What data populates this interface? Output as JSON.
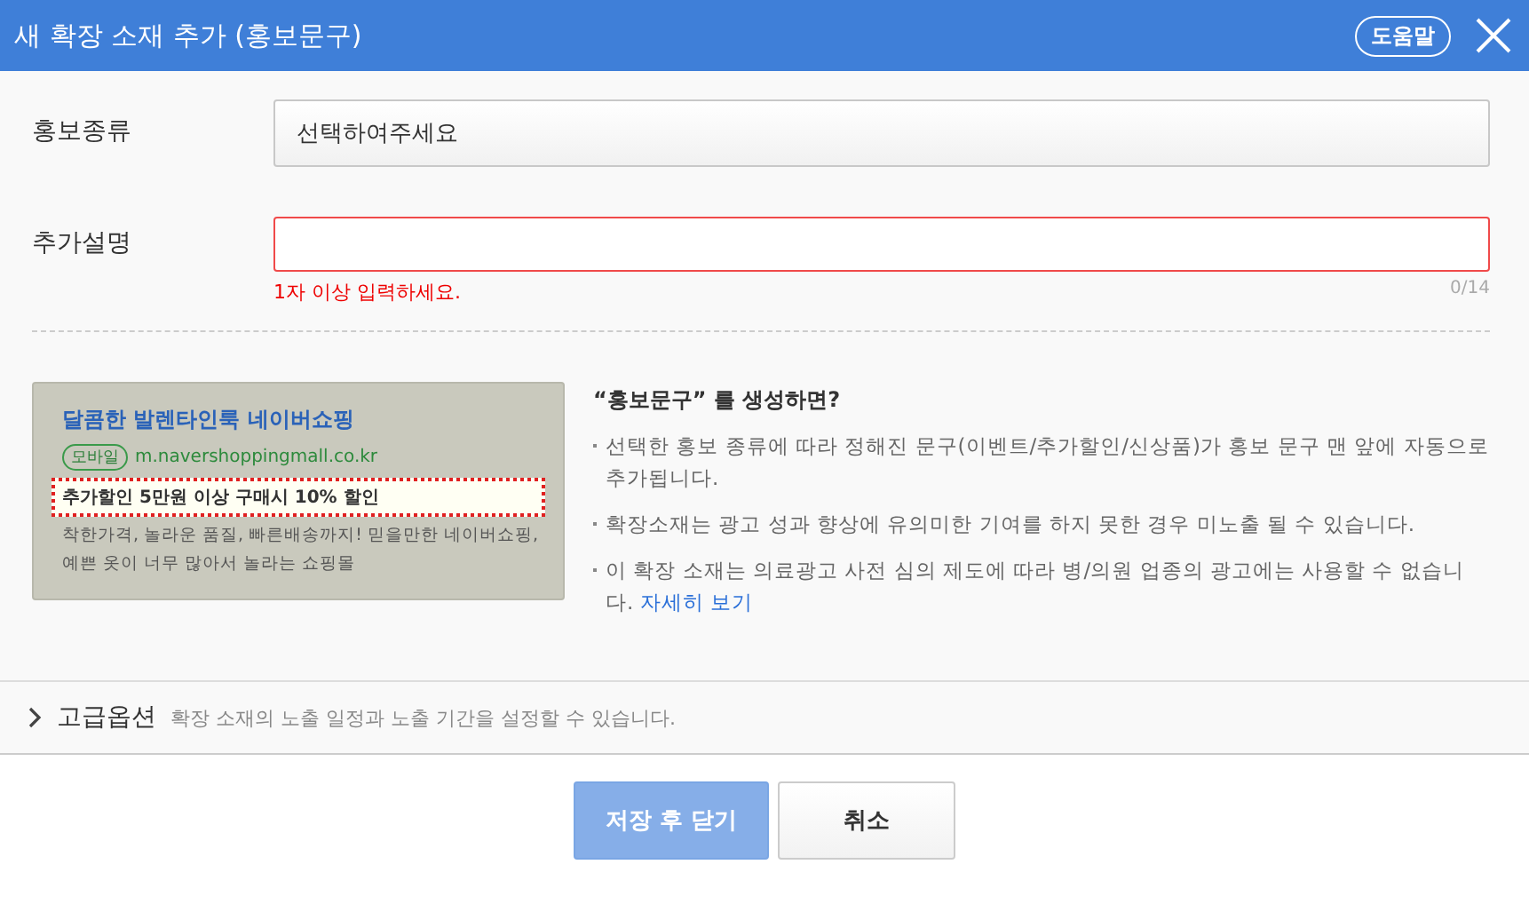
{
  "window": {
    "title": "새 확장 소재 추가 (홍보문구)",
    "help_button": "도움말"
  },
  "form": {
    "fields": [
      {
        "kind": "select",
        "label": "홍보종류",
        "value": "선택하여주세요"
      },
      {
        "kind": "text",
        "label": "추가설명",
        "invalid": true,
        "error": "1자 이상 입력하세요.",
        "counter": "0/14"
      }
    ]
  },
  "preview": {
    "title": "달콤한 발렌타인룩 네이버쇼핑",
    "badge": "모바일",
    "url": "m.navershoppingmall.co.kr",
    "highlight": "추가할인 5만원 이상 구매시 10% 할인",
    "description": "착한가격, 놀라운 품질, 빠른배송까지! 믿을만한 네이버쇼핑,\n예쁜 옷이 너무 많아서 놀라는 쇼핑몰"
  },
  "info": {
    "heading": "“홍보문구” 를 생성하면?",
    "bullets": [
      {
        "text": "선택한 홍보 종류에 따라 정해진 문구(이벤트/추가할인/신상품)가 홍보 문구 맨 앞에 자동으로 추가됩니다."
      },
      {
        "text": "확장소재는 광고 성과 향상에 유의미한 기여를 하지 못한 경우 미노출 될 수 있습니다."
      },
      {
        "text": "이 확장 소재는 의료광고 사전 심의 제도에 따라 병/의원 업종의 광고에는 사용할 수 없습니다.",
        "link": "자세히 보기"
      }
    ]
  },
  "advanced": {
    "label": "고급옵션",
    "expanded": false,
    "description": "확장 소재의 노출 일정과 노출 기간을 설정할 수 있습니다."
  },
  "buttons": [
    {
      "kind": "primary",
      "label": "저장 후 닫기",
      "disabled": true
    },
    {
      "kind": "secondary",
      "label": "취소",
      "disabled": false
    }
  ]
}
